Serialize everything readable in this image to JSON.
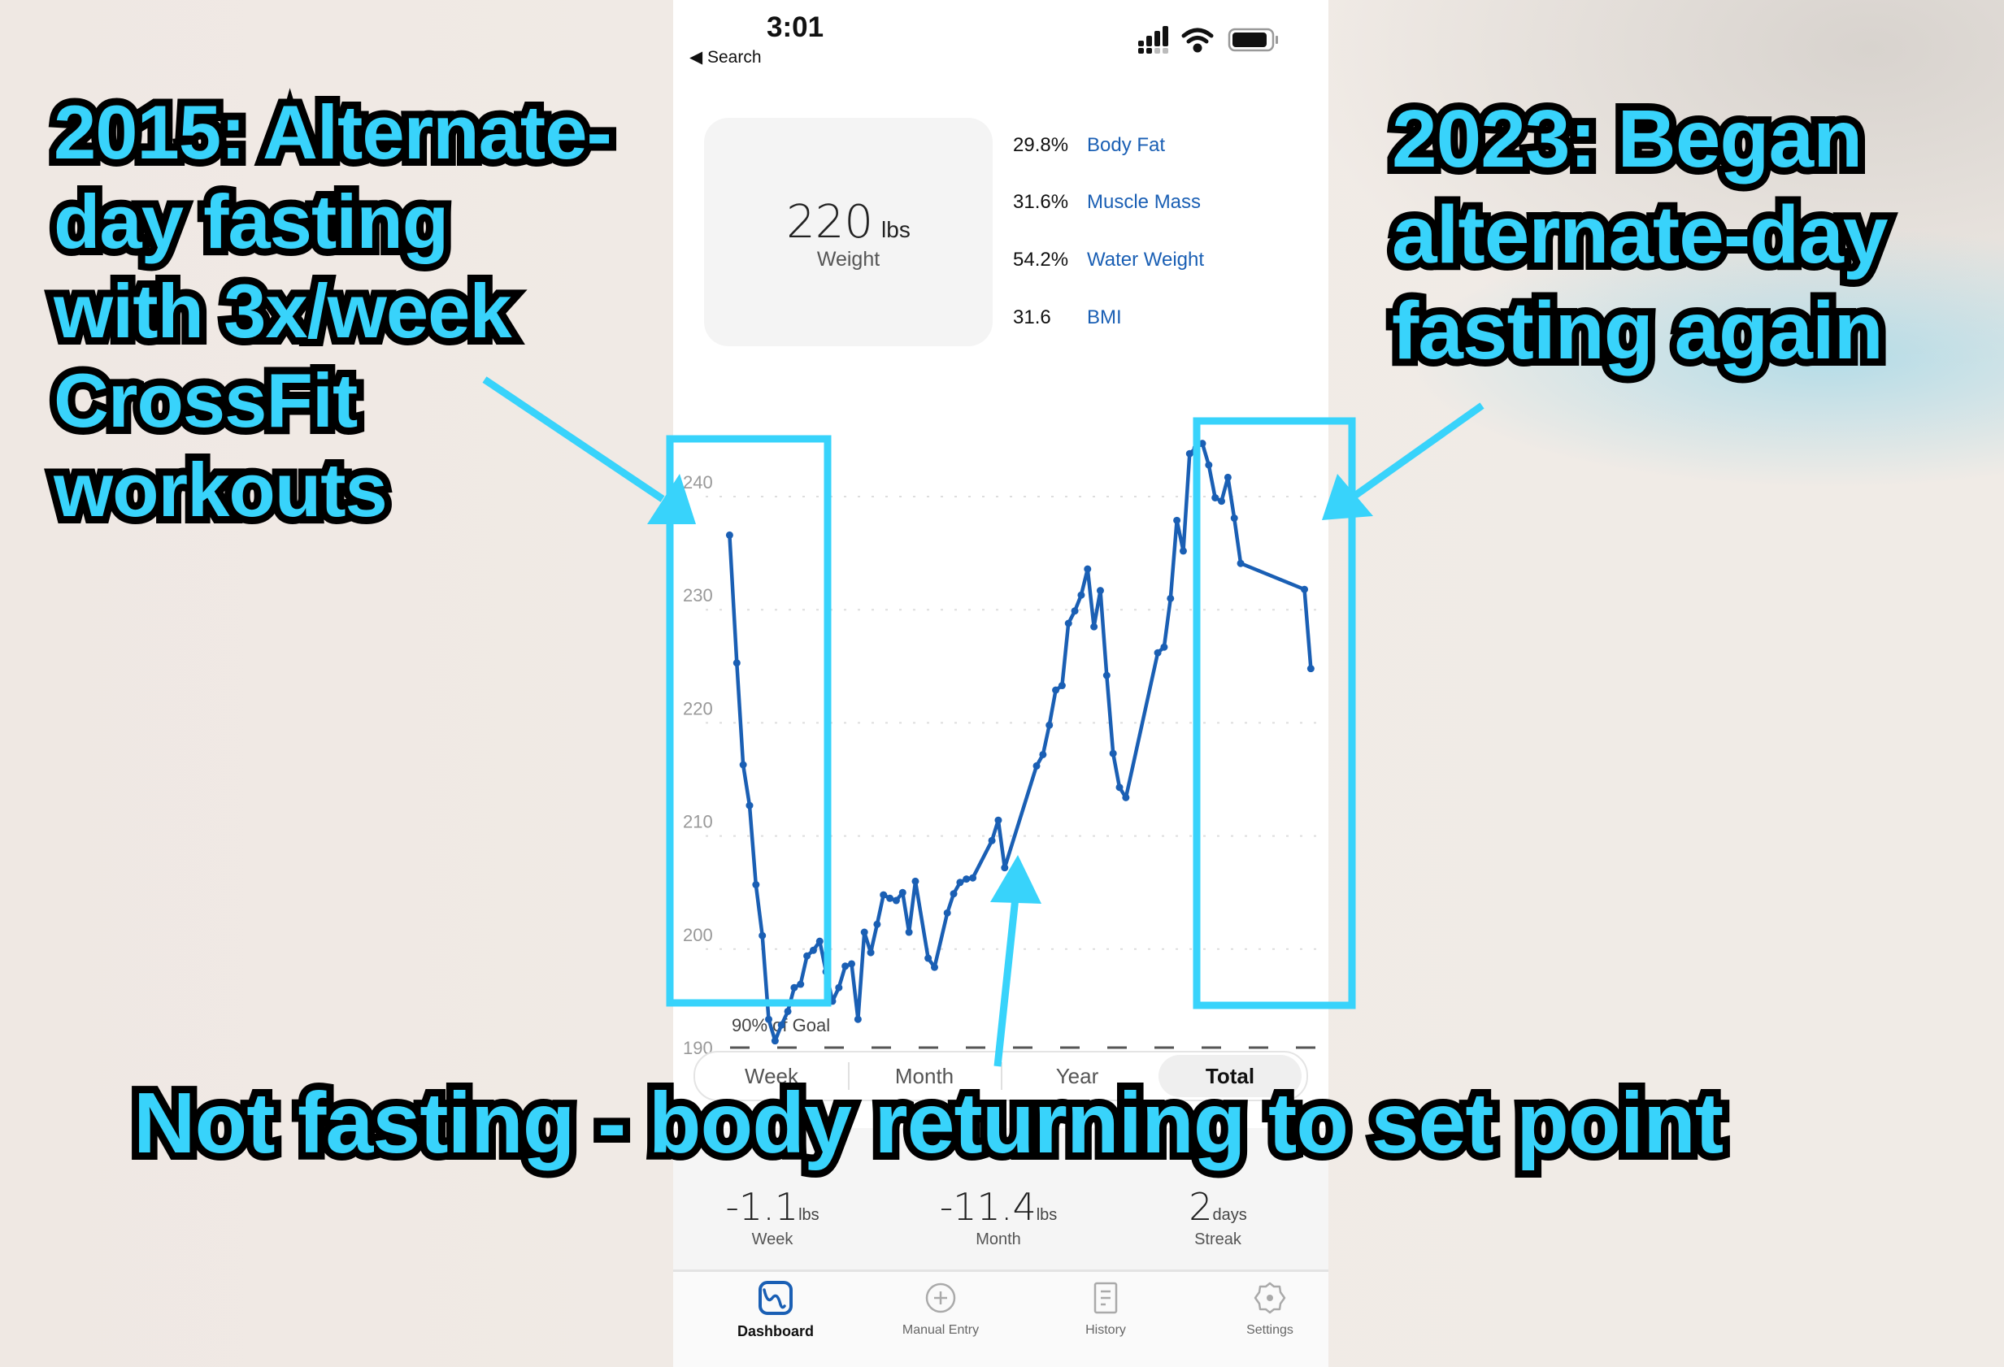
{
  "status_bar": {
    "time": "3:01",
    "back_label": "Search",
    "icons": [
      "signal-icon",
      "wifi-icon",
      "battery-icon"
    ]
  },
  "weight_card": {
    "value": "220",
    "unit": "lbs",
    "label": "Weight"
  },
  "metrics": [
    {
      "value": "29.8%",
      "label": "Body Fat"
    },
    {
      "value": "31.6%",
      "label": "Muscle Mass"
    },
    {
      "value": "54.2%",
      "label": "Water Weight"
    },
    {
      "value": "31.6",
      "label": "BMI"
    }
  ],
  "chart_data": {
    "type": "line",
    "yticks": [
      "240",
      "230",
      "220",
      "210",
      "200",
      "190"
    ],
    "ylim": [
      190,
      240
    ],
    "grid": true,
    "goal_line": {
      "value": 190,
      "label": "90% of Goal"
    },
    "line_color": "#1a5fb4",
    "values": [
      235.3,
      224,
      215,
      211.4,
      204.4,
      199.9,
      192.5,
      190.6,
      192,
      193.2,
      195.3,
      195.6,
      198.1,
      198.6,
      199.4,
      196.7,
      194.1,
      195.3,
      197.2,
      197.4,
      192.5,
      200.2,
      198.4,
      200.9,
      203.5,
      203.2,
      203,
      203.7,
      200.2,
      204.7,
      197.9,
      197.1,
      201.9,
      203.6,
      204.6,
      204.9,
      205,
      208.3,
      210.1,
      205.9,
      214.9,
      215.9,
      218.5,
      221.6,
      222,
      227.5,
      228.6,
      230,
      232.3,
      227.2,
      230.4,
      222.9,
      216,
      213,
      212.1,
      224.9,
      225.4,
      229.7,
      236.6,
      233.9,
      242.5,
      243,
      243.4,
      241.5,
      238.6,
      238.3,
      240.4,
      236.8,
      232.8,
      230.5,
      223.5
    ]
  },
  "range_selector": {
    "options": [
      "Week",
      "Month",
      "Year",
      "Total"
    ],
    "selected": "Total"
  },
  "summary": [
    {
      "value": "-1.1",
      "unit": "lbs",
      "label": "Week"
    },
    {
      "value": "-11.4",
      "unit": "lbs",
      "label": "Month"
    },
    {
      "value": "2",
      "unit": "days",
      "label": "Streak"
    }
  ],
  "tabs": [
    {
      "label": "Dashboard",
      "icon": "dashboard-icon",
      "active": true
    },
    {
      "label": "Manual Entry",
      "icon": "plus-circle-icon"
    },
    {
      "label": "History",
      "icon": "document-icon"
    },
    {
      "label": "Settings",
      "icon": "gear-icon"
    }
  ],
  "annotations": {
    "left": "2015: Alternate-\nday fasting\nwith 3x/week\nCrossFit\nworkouts",
    "right": "2023: Began\nalternate-day\nfasting again",
    "bottom": "Not fasting - body returning to set point",
    "color": "#38d3fb"
  }
}
